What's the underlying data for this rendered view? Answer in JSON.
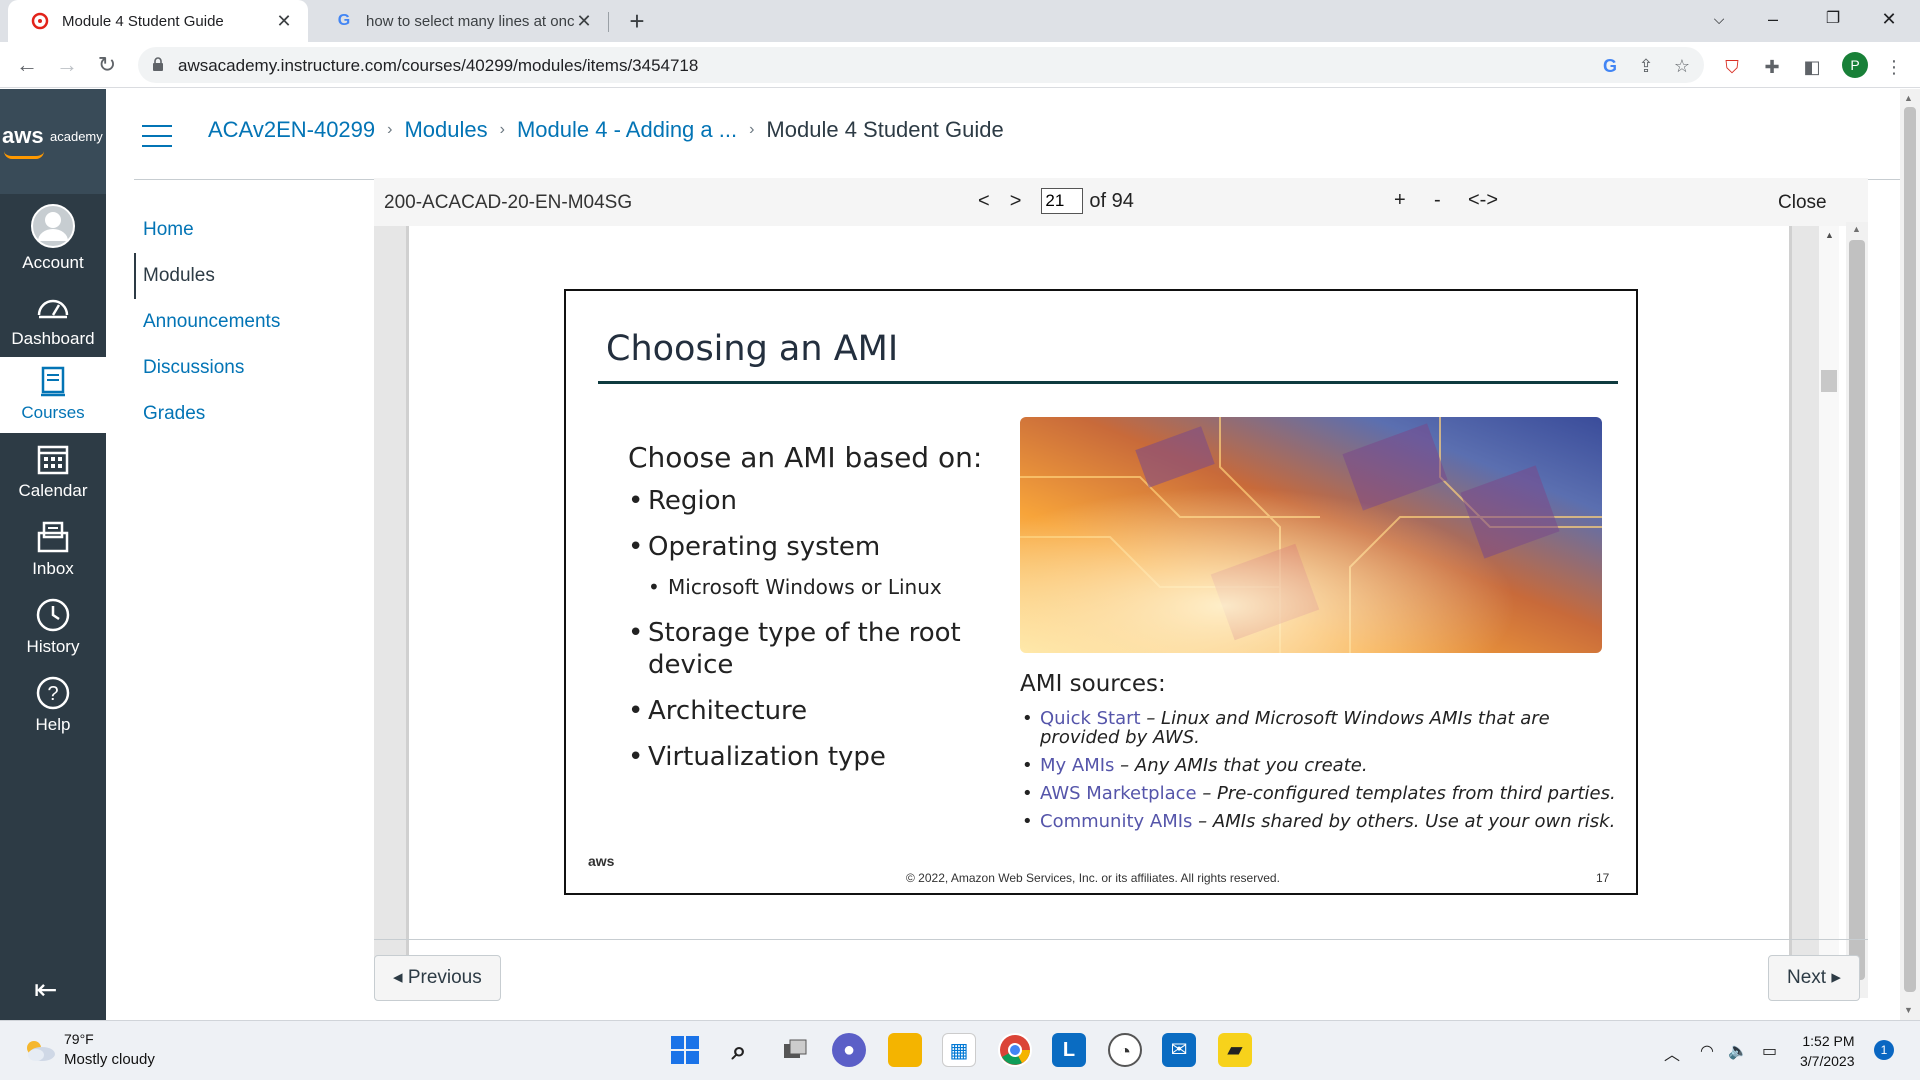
{
  "browser": {
    "tabs": [
      {
        "title": "Module 4 Student Guide",
        "active": true
      },
      {
        "title": "how to select many lines at once",
        "active": false
      }
    ],
    "url": "awsacademy.instructure.com/courses/40299/modules/items/3454718",
    "profile_initial": "P"
  },
  "global_nav": {
    "logo_aws": "aws",
    "logo_academy": "academy",
    "items": [
      {
        "label": "Account",
        "icon": "account-icon"
      },
      {
        "label": "Dashboard",
        "icon": "dashboard-icon"
      },
      {
        "label": "Courses",
        "icon": "courses-icon",
        "active": true
      },
      {
        "label": "Calendar",
        "icon": "calendar-icon"
      },
      {
        "label": "Inbox",
        "icon": "inbox-icon"
      },
      {
        "label": "History",
        "icon": "history-icon"
      },
      {
        "label": "Help",
        "icon": "help-icon"
      }
    ]
  },
  "breadcrumb": {
    "course": "ACAv2EN-40299",
    "modules": "Modules",
    "module": "Module 4 - Adding a ...",
    "current": "Module 4 Student Guide"
  },
  "course_nav": {
    "items": [
      "Home",
      "Modules",
      "Announcements",
      "Discussions",
      "Grades"
    ],
    "active": "Modules"
  },
  "viewer": {
    "doc_id": "200-ACACAD-20-EN-M04SG",
    "prev": "<",
    "next": ">",
    "page": "21",
    "of_total": "of 94",
    "zoom_in": "+",
    "zoom_out": "-",
    "fit": "<->",
    "close": "Close"
  },
  "slide": {
    "title": "Choosing an AMI",
    "left_heading": "Choose an AMI based on:",
    "criteria": [
      "Region",
      "Operating system",
      "Microsoft Windows or Linux",
      "Storage type of the root device",
      "Architecture",
      "Virtualization type"
    ],
    "sources_heading": "AMI sources:",
    "sources": [
      {
        "key": "Quick Start",
        "desc": "– Linux and Microsoft Windows AMIs that are provided by AWS."
      },
      {
        "key": "My AMIs",
        "desc": "– Any AMIs that you create."
      },
      {
        "key": "AWS Marketplace",
        "desc": "– Pre-configured templates from third parties."
      },
      {
        "key": "Community AMIs",
        "desc": "– AMIs shared by others. Use at your own risk."
      }
    ],
    "logo": "aws",
    "copyright": "© 2022, Amazon Web Services, Inc. or its affiliates. All rights reserved.",
    "number": "17"
  },
  "pager": {
    "previous": "◂ Previous",
    "next": "Next ▸"
  },
  "taskbar": {
    "temp": "79°F",
    "weather": "Mostly cloudy",
    "time": "1:52 PM",
    "date": "3/7/2023",
    "notifications": "1"
  },
  "colors": {
    "canvas_nav": "#2d3b45",
    "link": "#0374b5",
    "slide_rule": "#0f3b3f"
  }
}
